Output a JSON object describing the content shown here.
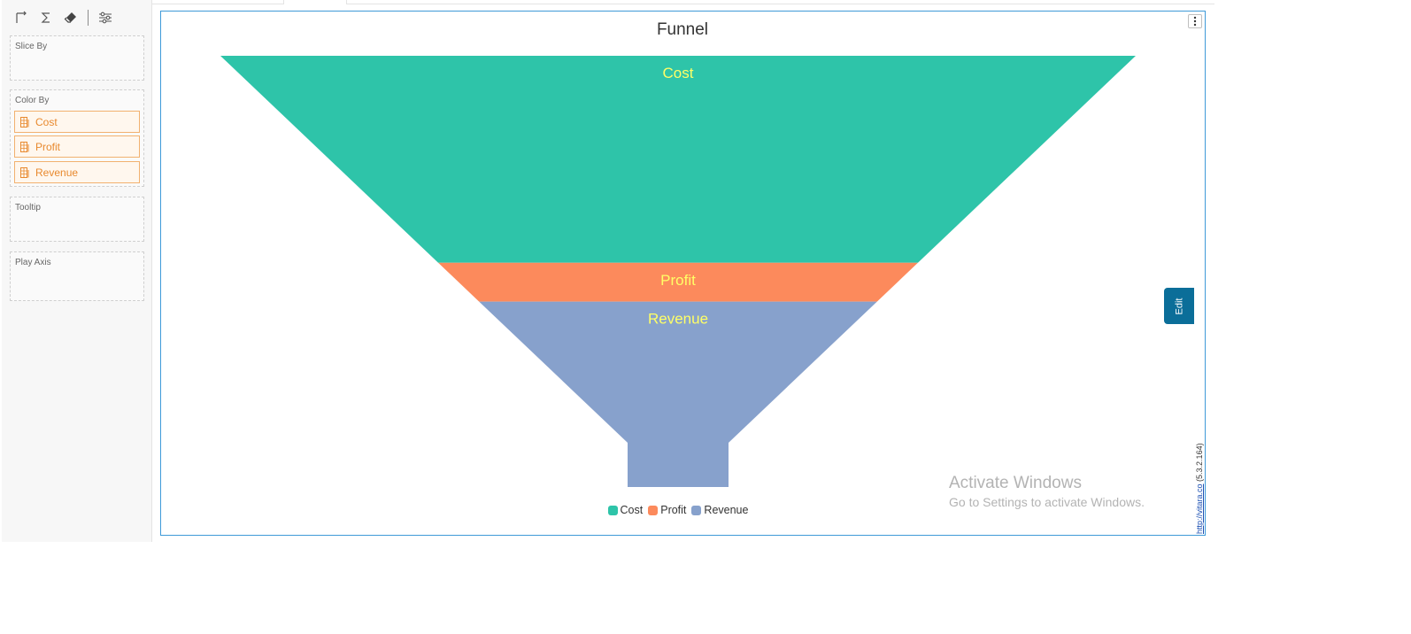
{
  "toolbar": {
    "tools": [
      {
        "icon": "axis-icon"
      },
      {
        "icon": "sigma-icon"
      },
      {
        "icon": "eraser-icon"
      },
      {
        "icon": "sliders-icon"
      }
    ]
  },
  "wells": {
    "slice_by": {
      "title": "Slice By"
    },
    "color_by": {
      "title": "Color By",
      "chips": [
        {
          "label": "Cost",
          "icon": "table-column-icon"
        },
        {
          "label": "Profit",
          "icon": "table-column-icon"
        },
        {
          "label": "Revenue",
          "icon": "table-column-icon"
        }
      ]
    },
    "tooltip": {
      "title": "Tooltip"
    },
    "play_axis": {
      "title": "Play Axis"
    }
  },
  "visual": {
    "title": "Funnel",
    "menu_icon": "vertical-ellipsis-icon",
    "edit_label": "Edit",
    "credit_link": "http://vitara.co",
    "credit_version": "(5.3.2.164)"
  },
  "watermark": {
    "title": "Activate Windows",
    "subtitle": "Go to Settings to activate Windows."
  },
  "colors": {
    "accent": "#0b6e99",
    "frame_border": "#3f9ad8",
    "chip_text": "#e8892e",
    "segment_label": "#ffff66"
  },
  "chart_data": {
    "type": "funnel",
    "title": "Funnel",
    "legend_position": "bottom-center",
    "series": [
      {
        "name": "Cost",
        "color": "#2ec4a9",
        "share": 0.48
      },
      {
        "name": "Profit",
        "color": "#fc8a5c",
        "share": 0.09
      },
      {
        "name": "Revenue",
        "color": "#87a1cc",
        "share": 0.43
      }
    ]
  }
}
